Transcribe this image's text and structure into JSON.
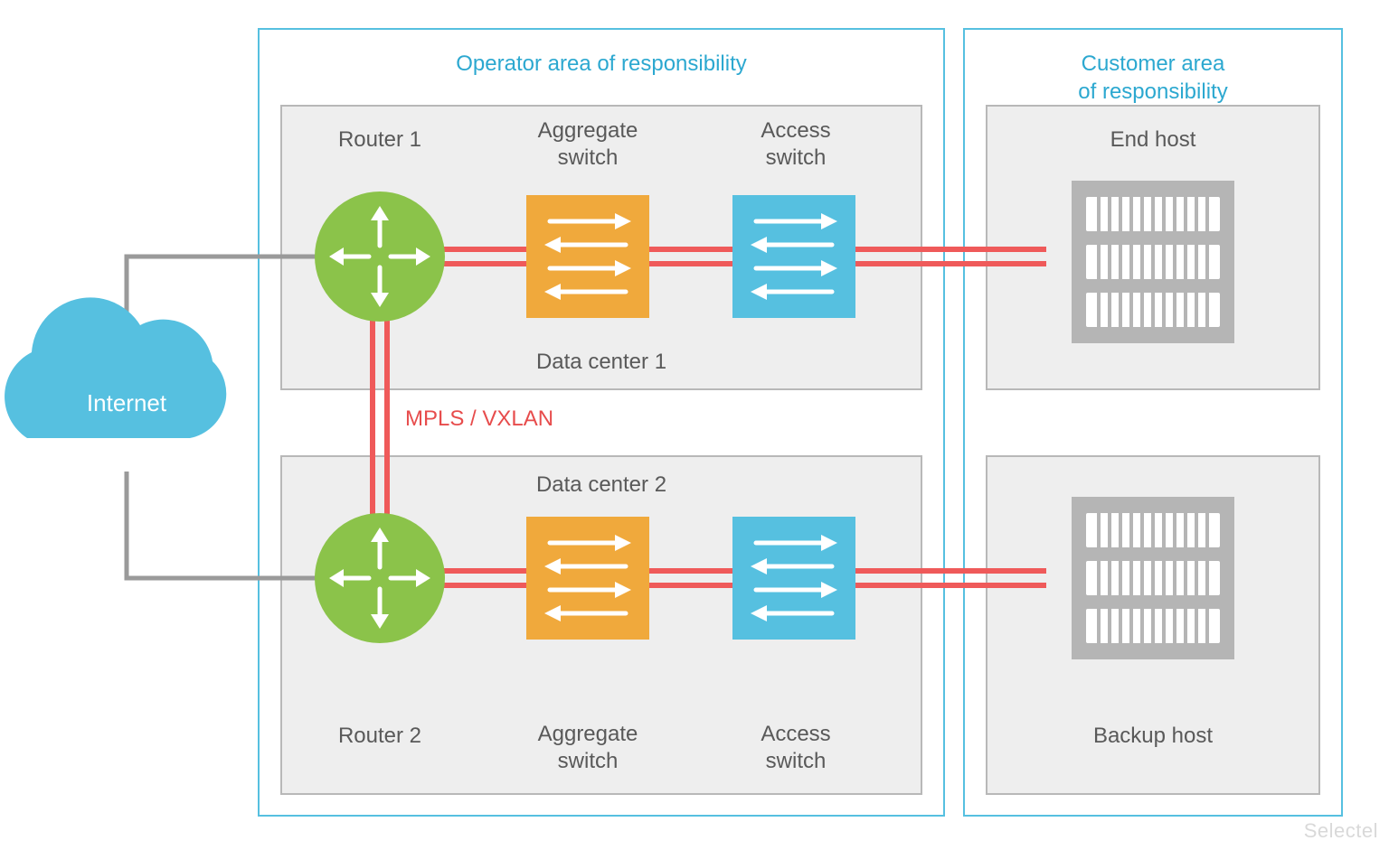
{
  "areas": {
    "operator": "Operator area of responsibility",
    "customer": "Customer area\nof responsibility"
  },
  "internet": "Internet",
  "dc1": {
    "caption": "Data center 1",
    "router": "Router 1",
    "agg": "Aggregate\nswitch",
    "access": "Access\nswitch"
  },
  "dc2": {
    "caption": "Data center 2",
    "router": "Router 2",
    "agg": "Aggregate\nswitch",
    "access": "Access\nswitch"
  },
  "hosts": {
    "end": "End host",
    "backup": "Backup host"
  },
  "interlink": "MPLS / VXLAN",
  "watermark": "Selectel"
}
